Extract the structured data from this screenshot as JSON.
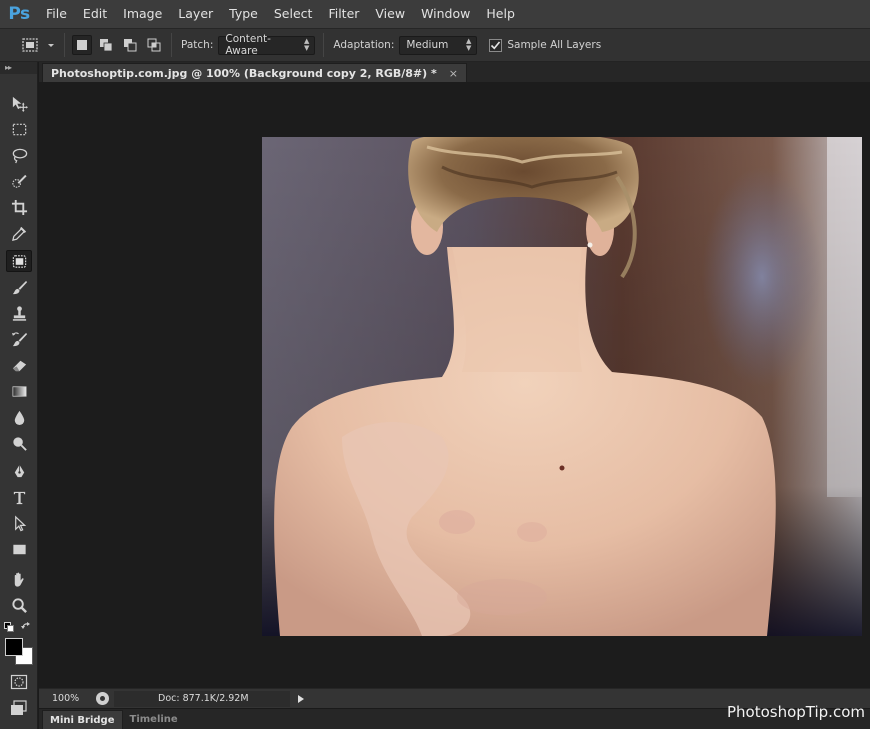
{
  "app": {
    "logo": "Ps"
  },
  "menu": [
    "File",
    "Edit",
    "Image",
    "Layer",
    "Type",
    "Select",
    "Filter",
    "View",
    "Window",
    "Help"
  ],
  "options": {
    "patch_label": "Patch:",
    "patch_value": "Content-Aware",
    "adaptation_label": "Adaptation:",
    "adaptation_value": "Medium",
    "sample_all_layers_label": "Sample All Layers",
    "sample_all_layers_checked": true
  },
  "tools": [
    {
      "name": "move-tool",
      "icon": "move-icon"
    },
    {
      "name": "marquee-tool",
      "icon": "marquee-icon"
    },
    {
      "name": "lasso-tool",
      "icon": "lasso-icon"
    },
    {
      "name": "quick-selection-tool",
      "icon": "quick-selection-icon"
    },
    {
      "name": "crop-tool",
      "icon": "crop-icon"
    },
    {
      "name": "eyedropper-tool",
      "icon": "eyedropper-icon"
    },
    {
      "name": "patch-tool",
      "icon": "patch-icon",
      "active": true
    },
    {
      "name": "brush-tool",
      "icon": "brush-icon"
    },
    {
      "name": "clone-stamp-tool",
      "icon": "stamp-icon"
    },
    {
      "name": "history-brush-tool",
      "icon": "history-brush-icon"
    },
    {
      "name": "eraser-tool",
      "icon": "eraser-icon"
    },
    {
      "name": "gradient-tool",
      "icon": "gradient-icon"
    },
    {
      "name": "blur-tool",
      "icon": "blur-drop-icon"
    },
    {
      "name": "dodge-tool",
      "icon": "dodge-icon"
    },
    {
      "name": "pen-tool",
      "icon": "pen-icon"
    },
    {
      "name": "type-tool",
      "icon": "type-icon"
    },
    {
      "name": "path-selection-tool",
      "icon": "path-selection-icon"
    },
    {
      "name": "rectangle-tool",
      "icon": "rectangle-icon"
    },
    {
      "name": "hand-tool",
      "icon": "hand-icon"
    },
    {
      "name": "zoom-tool",
      "icon": "zoom-icon"
    }
  ],
  "colors": {
    "foreground": "#000000",
    "background": "#ffffff",
    "accent": "#4aa3df"
  },
  "document": {
    "tab_title": "Photoshoptip.com.jpg @ 100% (Background copy 2, RGB/8#) *",
    "close_symbol": "×"
  },
  "status": {
    "zoom": "100%",
    "doc_info": "Doc: 877.1K/2.92M"
  },
  "bottom_tabs": {
    "mini_bridge": "Mini Bridge",
    "timeline": "Timeline"
  },
  "watermark": "PhotoshopTip.com"
}
